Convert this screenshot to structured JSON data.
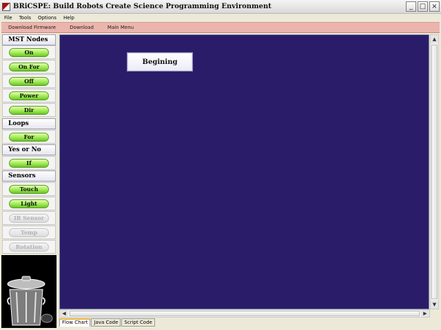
{
  "window": {
    "title": "BRiCSPE: Build Robots Create Science Programming Environment",
    "controls": [
      "_",
      "□",
      "×"
    ]
  },
  "menubar": {
    "items": [
      "File",
      "Tools",
      "Options",
      "Help"
    ]
  },
  "toolbar": {
    "items": [
      "Download Firmware",
      "Download",
      "Main Menu"
    ]
  },
  "sidebar": {
    "mst_nodes": {
      "label": "MST Nodes",
      "items": [
        "On",
        "On For",
        "Off",
        "Power",
        "Dir"
      ]
    },
    "loops": {
      "label": "Loops",
      "items": [
        "For"
      ]
    },
    "yes_or_no": {
      "label": "Yes or No",
      "items": [
        "If"
      ]
    },
    "sensors": {
      "label": "Sensors",
      "items": [
        "Touch",
        "Light"
      ],
      "disabled_items": [
        "IR Sensor",
        "Temp",
        "Rotation"
      ]
    }
  },
  "canvas": {
    "block_label": "Begining",
    "background": "#2b1c6a"
  },
  "tabs": [
    "Flow Chart",
    "Java Code",
    "Script Code"
  ],
  "active_tab": "Flow Chart",
  "colors": {
    "toolbar": "#ebb5ae",
    "button_green": "#96e84a",
    "active_tab_accent": "#e8b540"
  },
  "icons": {
    "app": "app-icon",
    "trash": "trash-can-icon"
  }
}
